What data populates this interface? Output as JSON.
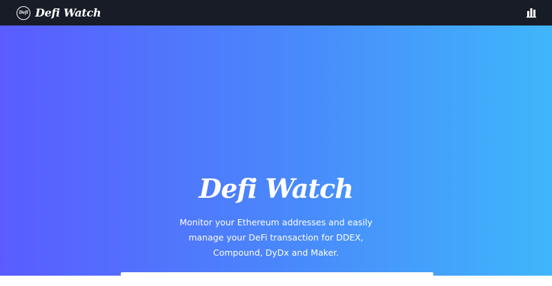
{
  "navbar": {
    "logo_text": "Defi",
    "brand_name": "Defi Watch",
    "menu_icon": "bar-chart-icon"
  },
  "hero": {
    "title": "Defi Watch",
    "description": "Monitor your Ethereum addresses and easily manage your DeFi transaction for DDEX, Compound, DyDx and Maker."
  },
  "colors": {
    "navbar_bg": "#171c26",
    "gradient_start": "#5a5cff",
    "gradient_end": "#3fb6fb",
    "text": "#ffffff"
  }
}
